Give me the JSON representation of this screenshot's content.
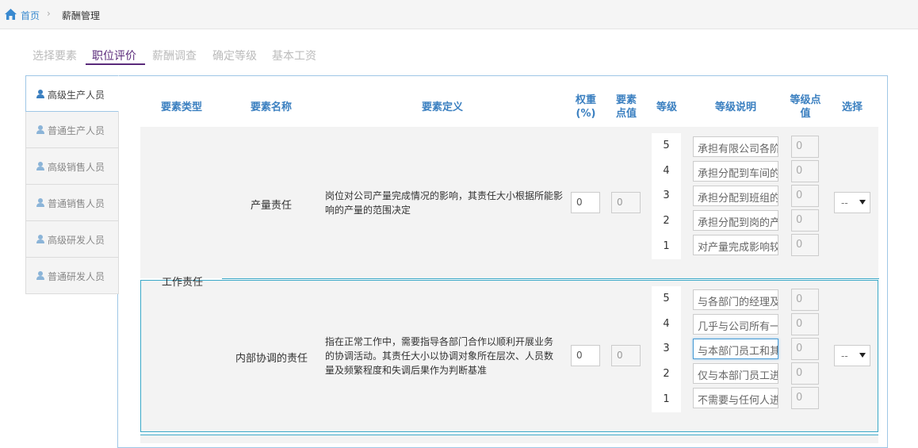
{
  "breadcrumb": {
    "home": "首页",
    "separator": "›",
    "current": "薪酬管理"
  },
  "steps": [
    "选择要素",
    "职位评价",
    "薪酬调查",
    "确定等级",
    "基本工资"
  ],
  "sidebar": {
    "items": [
      "高级生产人员",
      "普通生产人员",
      "高级销售人员",
      "普通销售人员",
      "高级研发人员",
      "普通研发人员"
    ]
  },
  "table": {
    "headers": {
      "type": "要素类型",
      "name": "要素名称",
      "definition": "要素定义",
      "weight": [
        "权重",
        "(%)"
      ],
      "points": [
        "要素",
        "点值"
      ],
      "level": "等级",
      "level_desc": "等级说明",
      "level_points": [
        "等级点",
        "值"
      ],
      "select": "选择"
    },
    "type_label": "工作责任",
    "rows": [
      {
        "name": "产量责任",
        "definition": "岗位对公司产量完成情况的影响，其责任大小根据所能影响的产量的范围决定",
        "weight": "0",
        "points": "0",
        "levels": [
          {
            "level": "5",
            "desc": "承担有限公司各阶",
            "points": "0"
          },
          {
            "level": "4",
            "desc": "承担分配到车间的",
            "points": "0"
          },
          {
            "level": "3",
            "desc": "承担分配到班组的",
            "points": "0"
          },
          {
            "level": "2",
            "desc": "承担分配到岗的产",
            "points": "0"
          },
          {
            "level": "1",
            "desc": "对产量完成影响较",
            "points": "0"
          }
        ],
        "select": "--"
      },
      {
        "name": "内部协调的责任",
        "definition": "指在正常工作中，需要指导各部门合作以顺利开展业务的协调活动。其责任大小以协调对象所在层次、人员数量及频繁程度和失调后果作为判断基准",
        "weight": "0",
        "points": "0",
        "levels": [
          {
            "level": "5",
            "desc": "与各部门的经理及",
            "points": "0"
          },
          {
            "level": "4",
            "desc": "几乎与公司所有一",
            "points": "0"
          },
          {
            "level": "3",
            "desc": "与本部门员工和其",
            "points": "0"
          },
          {
            "level": "2",
            "desc": "仅与本部门员工进",
            "points": "0"
          },
          {
            "level": "1",
            "desc": "不需要与任何人进",
            "points": "0"
          }
        ],
        "select": "--"
      }
    ]
  },
  "colors": {
    "accent_purple": "#5a2a7a",
    "link_blue": "#3a7fc0",
    "border_teal": "#3aa8c8"
  }
}
